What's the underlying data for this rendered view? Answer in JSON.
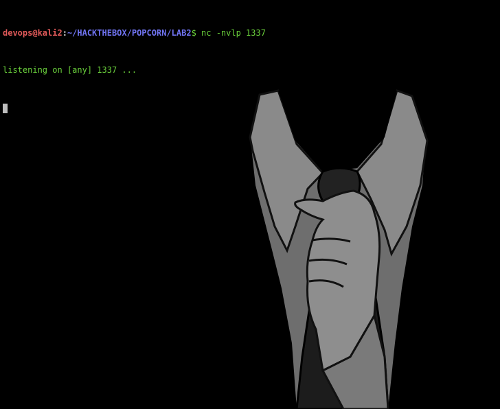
{
  "terminal": {
    "prompt": {
      "user_host": "devops@kali2",
      "separator": ":",
      "path": "~/HACKTHEBOX/POPCORN/LAB2",
      "symbol": "$",
      "command": " nc -nvlp 1337"
    },
    "output_lines": [
      "listening on [any] 1337 ..."
    ],
    "colors": {
      "background": "#000000",
      "user_host": "#e25a5a",
      "path": "#6f73f0",
      "text": "#6bd23c",
      "cursor": "#bdbdbd"
    },
    "background_art": "suit-tie-hand-illustration"
  }
}
